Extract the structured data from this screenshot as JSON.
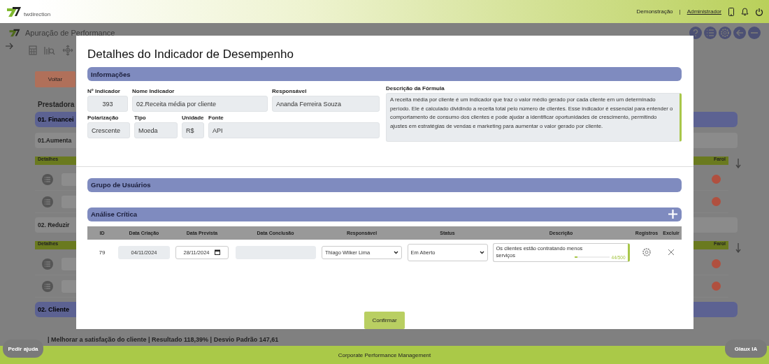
{
  "header": {
    "brand": "twdirection",
    "environment": "Demonstração",
    "separator": "|",
    "user": "Administrador"
  },
  "page": {
    "title": "Apuração de Performance",
    "back_button": "Voltar",
    "company": "Prestadora",
    "groups": [
      {
        "kind": "band",
        "label": "01. Financei"
      },
      {
        "kind": "subband",
        "label": "01.Aumenta"
      },
      {
        "kind": "table",
        "details": "Detalhes",
        "farol": "Farol",
        "rows": [
          {
            "color": "#b0503f"
          },
          {
            "color": "#b0503f"
          }
        ]
      },
      {
        "kind": "subband",
        "label": "02. Reduzir"
      },
      {
        "kind": "table",
        "details": "Detalhes",
        "farol": "Farol",
        "rows": [
          {
            "color": "#b0503f"
          },
          {
            "color": "#b0503f"
          }
        ]
      },
      {
        "kind": "band",
        "label": "02. Cliente"
      }
    ],
    "summary": "| Melhorar a satisfação do cliente | Resultado 118,39% | Desvio Padrão 147,61"
  },
  "modal": {
    "title": "Detalhes do Indicador de Desempenho",
    "info": {
      "heading": "Informações",
      "fields": [
        {
          "label": "Nº Indicador",
          "value": "393",
          "kind": "number"
        },
        {
          "label": "Nome Indicador",
          "value": "02.Receita média por cliente",
          "kind": "text"
        },
        {
          "label": "Responsável",
          "value": "Ananda Ferreira Souza",
          "kind": "text"
        },
        {
          "label": "Polarização",
          "value": "Crescente",
          "kind": "text"
        },
        {
          "label": "Tipo",
          "value": "Moeda",
          "kind": "text"
        },
        {
          "label": "Unidade",
          "value": "R$",
          "kind": "text"
        },
        {
          "label": "Fonte",
          "value": "API",
          "kind": "text"
        }
      ],
      "formula": {
        "label": "Descrição da Fórmula",
        "value": "A receita média por cliente é um indicador que traz o valor médio gerado por cada cliente em um determinado período. Ele é calculado dividindo a receita total pelo número de clientes. Esse indicador é essencial para entender o comportamento de consumo dos clientes e pode ajudar a identificar oportunidades de crescimento, permitindo ajustes em estratégias de vendas e marketing para aumentar o valor gerado por cliente."
      }
    },
    "users": {
      "heading": "Grupo de Usuários"
    },
    "analysis": {
      "heading": "Análise Crítica",
      "columns": [
        "ID",
        "Data Criação",
        "Data Prevista",
        "Data Conclusão",
        "Responsável",
        "Status",
        "Descrição",
        "Registros",
        "Excluir"
      ],
      "rows": [
        {
          "id": "79",
          "created": {
            "value": "04/11/2024",
            "disabled": true
          },
          "due": {
            "value": "28/11/2024",
            "disabled": false
          },
          "completed": {
            "disabled": true
          },
          "owner": "Thiago Wilker Lima",
          "status": "Em Aberto",
          "description": "Os clientes estão contratando menos serviços",
          "counter": "44/500",
          "level": 0.088
        }
      ]
    },
    "confirm": "Confirmar"
  },
  "help_button": "Pedir ajuda",
  "footer": "Corporate Performance Management",
  "assistant_button": "Glaux IA"
}
